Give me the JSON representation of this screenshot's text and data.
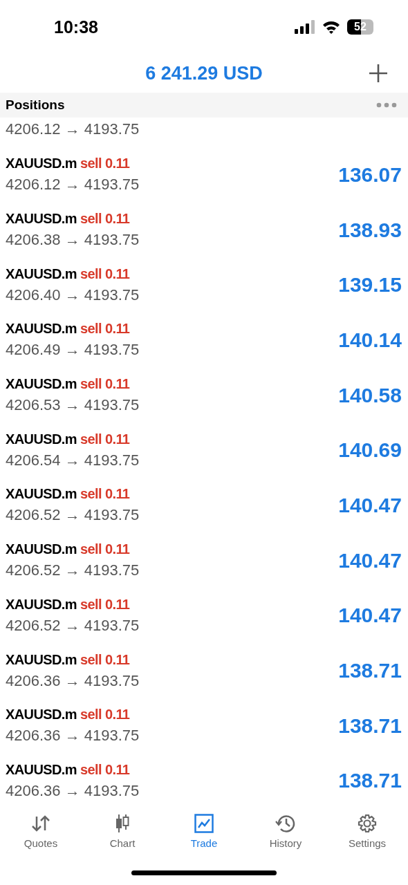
{
  "status_bar": {
    "time": "10:38",
    "battery": "52"
  },
  "header": {
    "balance": "6 241.29 USD"
  },
  "section": {
    "title": "Positions"
  },
  "partial_row": {
    "prices": "4206.12 → 4193.75"
  },
  "positions": [
    {
      "symbol": "XAUUSD.m",
      "side": "sell 0.11",
      "prices": "4206.12 → 4193.75",
      "profit": "136.07"
    },
    {
      "symbol": "XAUUSD.m",
      "side": "sell 0.11",
      "prices": "4206.38 → 4193.75",
      "profit": "138.93"
    },
    {
      "symbol": "XAUUSD.m",
      "side": "sell 0.11",
      "prices": "4206.40 → 4193.75",
      "profit": "139.15"
    },
    {
      "symbol": "XAUUSD.m",
      "side": "sell 0.11",
      "prices": "4206.49 → 4193.75",
      "profit": "140.14"
    },
    {
      "symbol": "XAUUSD.m",
      "side": "sell 0.11",
      "prices": "4206.53 → 4193.75",
      "profit": "140.58"
    },
    {
      "symbol": "XAUUSD.m",
      "side": "sell 0.11",
      "prices": "4206.54 → 4193.75",
      "profit": "140.69"
    },
    {
      "symbol": "XAUUSD.m",
      "side": "sell 0.11",
      "prices": "4206.52 → 4193.75",
      "profit": "140.47"
    },
    {
      "symbol": "XAUUSD.m",
      "side": "sell 0.11",
      "prices": "4206.52 → 4193.75",
      "profit": "140.47"
    },
    {
      "symbol": "XAUUSD.m",
      "side": "sell 0.11",
      "prices": "4206.52 → 4193.75",
      "profit": "140.47"
    },
    {
      "symbol": "XAUUSD.m",
      "side": "sell 0.11",
      "prices": "4206.36 → 4193.75",
      "profit": "138.71"
    },
    {
      "symbol": "XAUUSD.m",
      "side": "sell 0.11",
      "prices": "4206.36 → 4193.75",
      "profit": "138.71"
    },
    {
      "symbol": "XAUUSD.m",
      "side": "sell 0.11",
      "prices": "4206.36 → 4193.75",
      "profit": "138.71"
    }
  ],
  "tabs": [
    {
      "kind": "quotes",
      "label": "Quotes",
      "selected": false
    },
    {
      "kind": "chart",
      "label": "Chart",
      "selected": false
    },
    {
      "kind": "trade",
      "label": "Trade",
      "selected": true
    },
    {
      "kind": "history",
      "label": "History",
      "selected": false
    },
    {
      "kind": "settings",
      "label": "Settings",
      "selected": false
    }
  ]
}
